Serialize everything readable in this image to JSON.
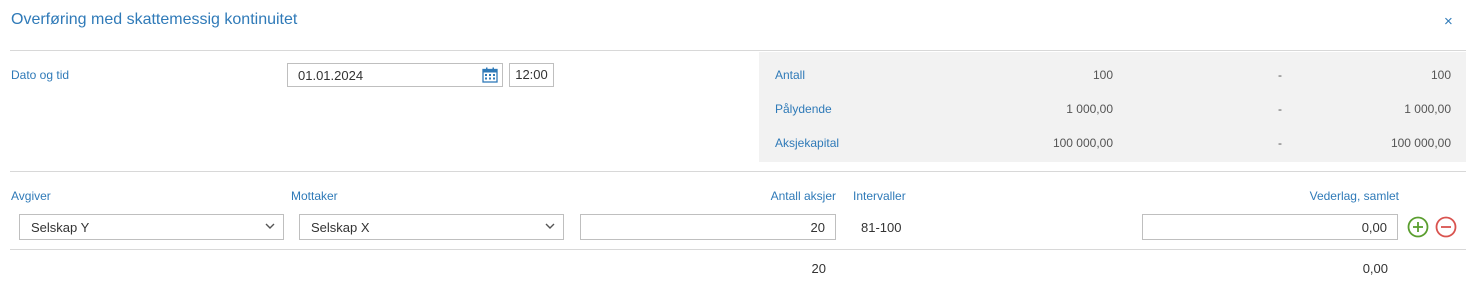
{
  "dialog": {
    "title": "Overføring med skattemessig kontinuitet",
    "close": "×"
  },
  "date_time": {
    "label": "Dato og tid",
    "date": "01.01.2024",
    "time": "12:00"
  },
  "summary": {
    "rows": [
      {
        "label": "Antall",
        "before": "100",
        "sep": "-",
        "after": "100"
      },
      {
        "label": "Pålydende",
        "before": "1 000,00",
        "sep": "-",
        "after": "1 000,00"
      },
      {
        "label": "Aksjekapital",
        "before": "100 000,00",
        "sep": "-",
        "after": "100 000,00"
      }
    ]
  },
  "table": {
    "headers": {
      "giver": "Avgiver",
      "receiver": "Mottaker",
      "shares": "Antall aksjer",
      "intervals": "Intervaller",
      "consideration": "Vederlag, samlet"
    },
    "row": {
      "giver": "Selskap Y",
      "receiver": "Selskap X",
      "shares": "20",
      "intervals": "81-100",
      "consideration": "0,00"
    },
    "totals": {
      "shares": "20",
      "consideration": "0,00"
    }
  },
  "colors": {
    "accent": "#2f7ab8",
    "add": "#5a9e2f",
    "remove": "#d9534f"
  }
}
